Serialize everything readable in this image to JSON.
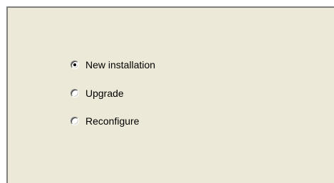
{
  "options": [
    {
      "label": "New installation",
      "checked": true
    },
    {
      "label": "Upgrade",
      "checked": false
    },
    {
      "label": "Reconfigure",
      "checked": false
    }
  ]
}
